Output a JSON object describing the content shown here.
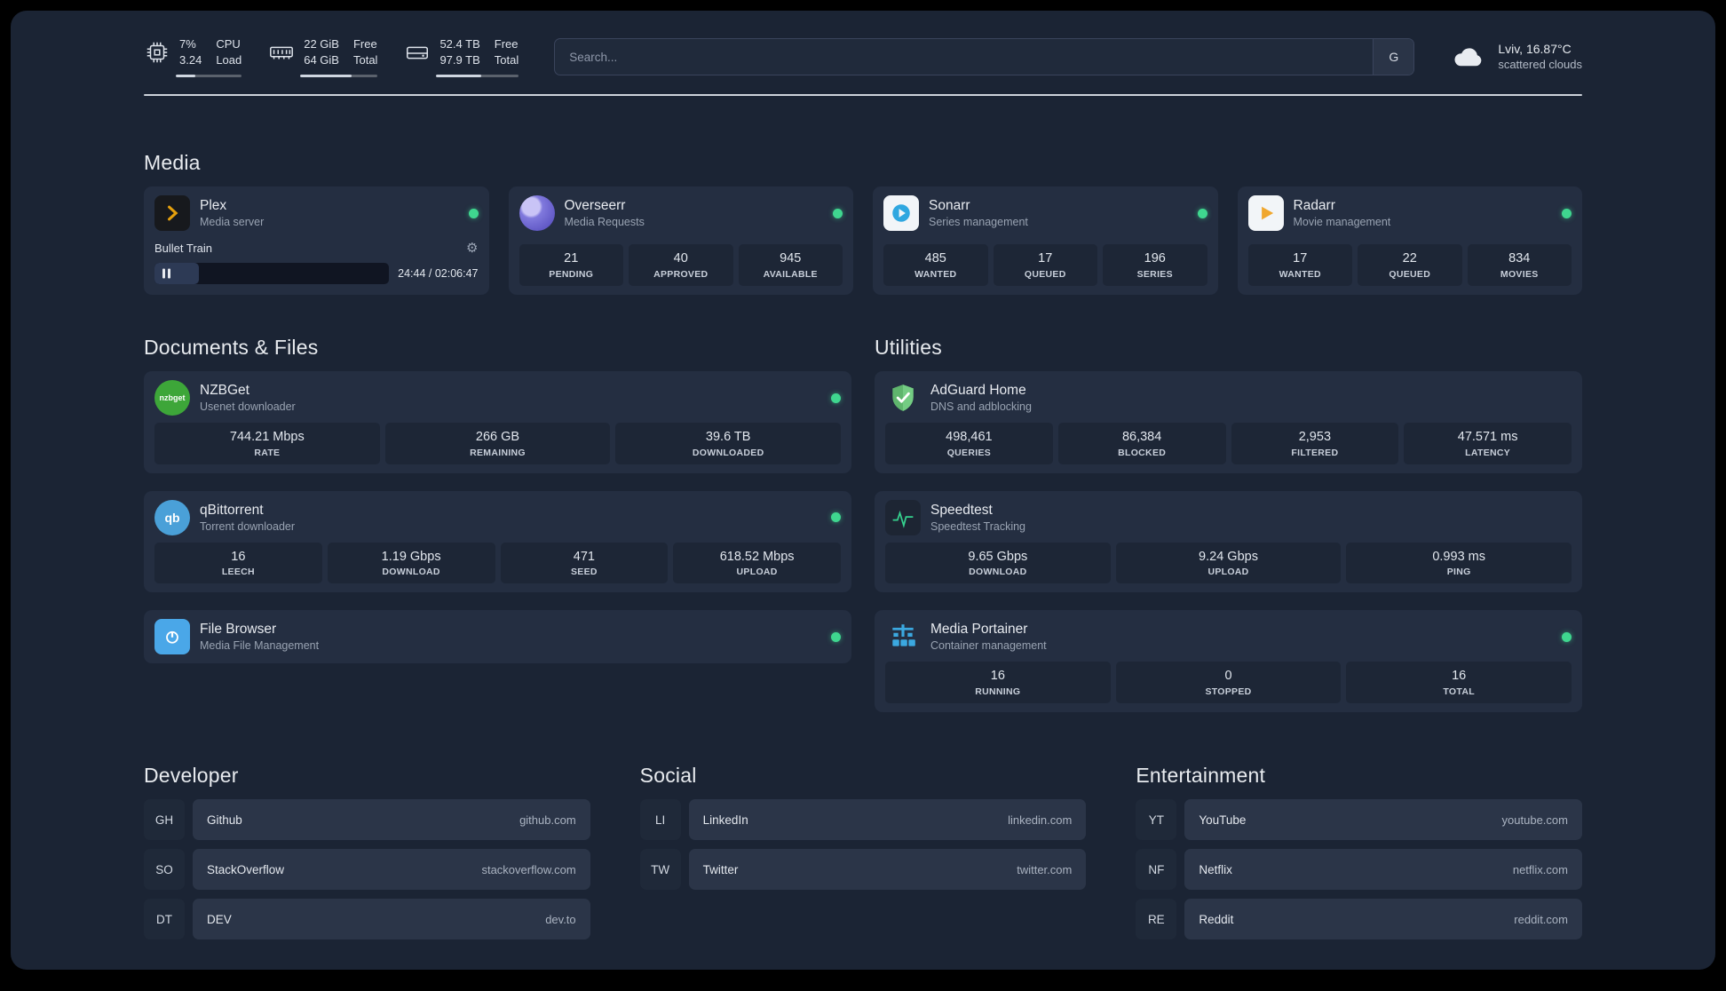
{
  "icons": {
    "gear": "⚙"
  },
  "topbar": {
    "cpu": {
      "value1": "7%",
      "value2": "3.24",
      "label1": "CPU",
      "label2": "Load",
      "bar_style": "width:30%"
    },
    "memory": {
      "value1": "22 GiB",
      "value2": "64 GiB",
      "label1": "Free",
      "label2": "Total",
      "bar_style": "width:66%"
    },
    "disk": {
      "value1": "52.4 TB",
      "value2": "97.9 TB",
      "label1": "Free",
      "label2": "Total",
      "bar_style": "width:54%"
    },
    "search": {
      "placeholder": "Search...",
      "button_label": "G"
    },
    "weather": {
      "location": "Lviv, 16.87°C",
      "condition": "scattered clouds"
    }
  },
  "sections": {
    "media": {
      "title": "Media"
    },
    "documents": {
      "title": "Documents & Files"
    },
    "utilities": {
      "title": "Utilities"
    }
  },
  "apps": {
    "plex": {
      "name": "Plex",
      "subtitle": "Media server",
      "now_playing": "Bullet Train",
      "time": "24:44 / 02:06:47",
      "progress_style": "width:19%"
    },
    "overseerr": {
      "name": "Overseerr",
      "subtitle": "Media Requests",
      "stats": [
        {
          "value": "21",
          "label": "PENDING"
        },
        {
          "value": "40",
          "label": "APPROVED"
        },
        {
          "value": "945",
          "label": "AVAILABLE"
        }
      ]
    },
    "sonarr": {
      "name": "Sonarr",
      "subtitle": "Series management",
      "stats": [
        {
          "value": "485",
          "label": "WANTED"
        },
        {
          "value": "17",
          "label": "QUEUED"
        },
        {
          "value": "196",
          "label": "SERIES"
        }
      ]
    },
    "radarr": {
      "name": "Radarr",
      "subtitle": "Movie management",
      "stats": [
        {
          "value": "17",
          "label": "WANTED"
        },
        {
          "value": "22",
          "label": "QUEUED"
        },
        {
          "value": "834",
          "label": "MOVIES"
        }
      ]
    },
    "nzbget": {
      "name": "NZBGet",
      "subtitle": "Usenet downloader",
      "icon_text": "nzbget",
      "stats": [
        {
          "value": "744.21 Mbps",
          "label": "RATE"
        },
        {
          "value": "266 GB",
          "label": "REMAINING"
        },
        {
          "value": "39.6 TB",
          "label": "DOWNLOADED"
        }
      ]
    },
    "qbittorrent": {
      "name": "qBittorrent",
      "subtitle": "Torrent downloader",
      "icon_text": "qb",
      "stats": [
        {
          "value": "16",
          "label": "LEECH"
        },
        {
          "value": "1.19 Gbps",
          "label": "DOWNLOAD"
        },
        {
          "value": "471",
          "label": "SEED"
        },
        {
          "value": "618.52 Mbps",
          "label": "UPLOAD"
        }
      ]
    },
    "filebrowser": {
      "name": "File Browser",
      "subtitle": "Media File Management"
    },
    "adguard": {
      "name": "AdGuard Home",
      "subtitle": "DNS and adblocking",
      "stats": [
        {
          "value": "498,461",
          "label": "QUERIES"
        },
        {
          "value": "86,384",
          "label": "BLOCKED"
        },
        {
          "value": "2,953",
          "label": "FILTERED"
        },
        {
          "value": "47.571 ms",
          "label": "LATENCY"
        }
      ]
    },
    "speedtest": {
      "name": "Speedtest",
      "subtitle": "Speedtest Tracking",
      "stats": [
        {
          "value": "9.65 Gbps",
          "label": "DOWNLOAD"
        },
        {
          "value": "9.24 Gbps",
          "label": "UPLOAD"
        },
        {
          "value": "0.993 ms",
          "label": "PING"
        }
      ]
    },
    "portainer": {
      "name": "Media Portainer",
      "subtitle": "Container management",
      "stats": [
        {
          "value": "16",
          "label": "RUNNING"
        },
        {
          "value": "0",
          "label": "STOPPED"
        },
        {
          "value": "16",
          "label": "TOTAL"
        }
      ]
    }
  },
  "bookmarks": {
    "developer": {
      "title": "Developer",
      "items": [
        {
          "abbr": "GH",
          "name": "Github",
          "url": "github.com"
        },
        {
          "abbr": "SO",
          "name": "StackOverflow",
          "url": "stackoverflow.com"
        },
        {
          "abbr": "DT",
          "name": "DEV",
          "url": "dev.to"
        }
      ]
    },
    "social": {
      "title": "Social",
      "items": [
        {
          "abbr": "LI",
          "name": "LinkedIn",
          "url": "linkedin.com"
        },
        {
          "abbr": "TW",
          "name": "Twitter",
          "url": "twitter.com"
        }
      ]
    },
    "entertainment": {
      "title": "Entertainment",
      "items": [
        {
          "abbr": "YT",
          "name": "YouTube",
          "url": "youtube.com"
        },
        {
          "abbr": "NF",
          "name": "Netflix",
          "url": "netflix.com"
        },
        {
          "abbr": "RE",
          "name": "Reddit",
          "url": "reddit.com"
        }
      ]
    }
  }
}
